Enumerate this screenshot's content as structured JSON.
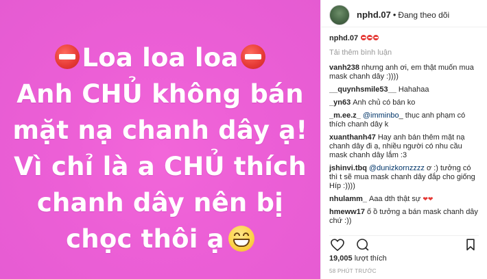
{
  "image": {
    "line1": "Loa loa loa",
    "line2": "Anh CHỦ không bán",
    "line3": "mặt nạ chanh dây ạ!",
    "line4": "Vì chỉ là a CHỦ thích",
    "line5": "chanh dây nên bị",
    "line6": "chọc thôi ạ",
    "background_color": "#ec5fd6",
    "emoji_start": "no-entry-icon",
    "emoji_end": "grinning-face-icon"
  },
  "header": {
    "username": "nphd.07",
    "separator": "•",
    "follow_status": "Đang theo dõi"
  },
  "caption": {
    "username": "nphd.07"
  },
  "load_more": "Tải thêm bình luận",
  "comments": [
    {
      "user": "vanh238",
      "text": "nhưng anh ơi, em thật muốn mua mask chanh dây :))))"
    },
    {
      "user": "__quynhsmile53__",
      "text": "Hahahaa"
    },
    {
      "user": "_yn63",
      "text": "Anh chủ có bán ko"
    },
    {
      "user": "_m.ee.z_",
      "mention": "@imminbo",
      "text": "_ thục anh phạm có thích chanh dây k"
    },
    {
      "user": "xuanthanh47",
      "text": "Hay anh bán thêm mặt nạ chanh dây đi ạ, nhiều người có nhu cầu mask chanh dây lắm :3"
    },
    {
      "user": "jshinvi.tbq",
      "mention": "@dunizkornzzzz",
      "text": "ơ :) tưởng có thì t sẽ mua mask chanh dây đắp cho giống Híp :))))"
    },
    {
      "user": "nhulamm_",
      "text": "Aaa dth thật sự"
    },
    {
      "user": "hmeww17",
      "text": "ố ồ tưởng a bán mask chanh dây chứ :))"
    }
  ],
  "likes": {
    "count": "19,005",
    "label": "lượt thích"
  },
  "time_ago": "58 PHÚT TRƯỚC",
  "colors": {
    "text": "#262626",
    "muted": "#999999",
    "mention": "#003569",
    "divider": "#efefef"
  }
}
